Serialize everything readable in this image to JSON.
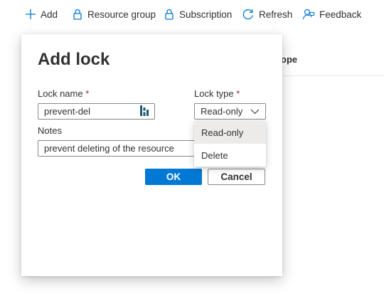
{
  "toolbar": {
    "add_label": "Add",
    "resource_group_label": "Resource group",
    "subscription_label": "Subscription",
    "refresh_label": "Refresh",
    "feedback_label": "Feedback"
  },
  "background": {
    "column_header_partial": "ope"
  },
  "dialog": {
    "title": "Add lock",
    "lock_name": {
      "label": "Lock name",
      "required_mark": "*",
      "value": "prevent-del"
    },
    "lock_type": {
      "label": "Lock type",
      "required_mark": "*",
      "selected": "Read-only",
      "options": [
        "Read-only",
        "Delete"
      ]
    },
    "notes": {
      "label": "Notes",
      "value": "prevent deleting of the resource"
    },
    "ok_label": "OK",
    "cancel_label": "Cancel"
  },
  "colors": {
    "accent": "#0078d4",
    "text": "#323130",
    "required": "#a4262c",
    "border": "#8a8886",
    "selected_option_bg": "#edebe9",
    "password_manager_icon": "#1f5a6e"
  },
  "icons": [
    "add-icon",
    "lock-icon",
    "refresh-icon",
    "feedback-icon",
    "chevron-down-icon",
    "password-manager-icon"
  ]
}
